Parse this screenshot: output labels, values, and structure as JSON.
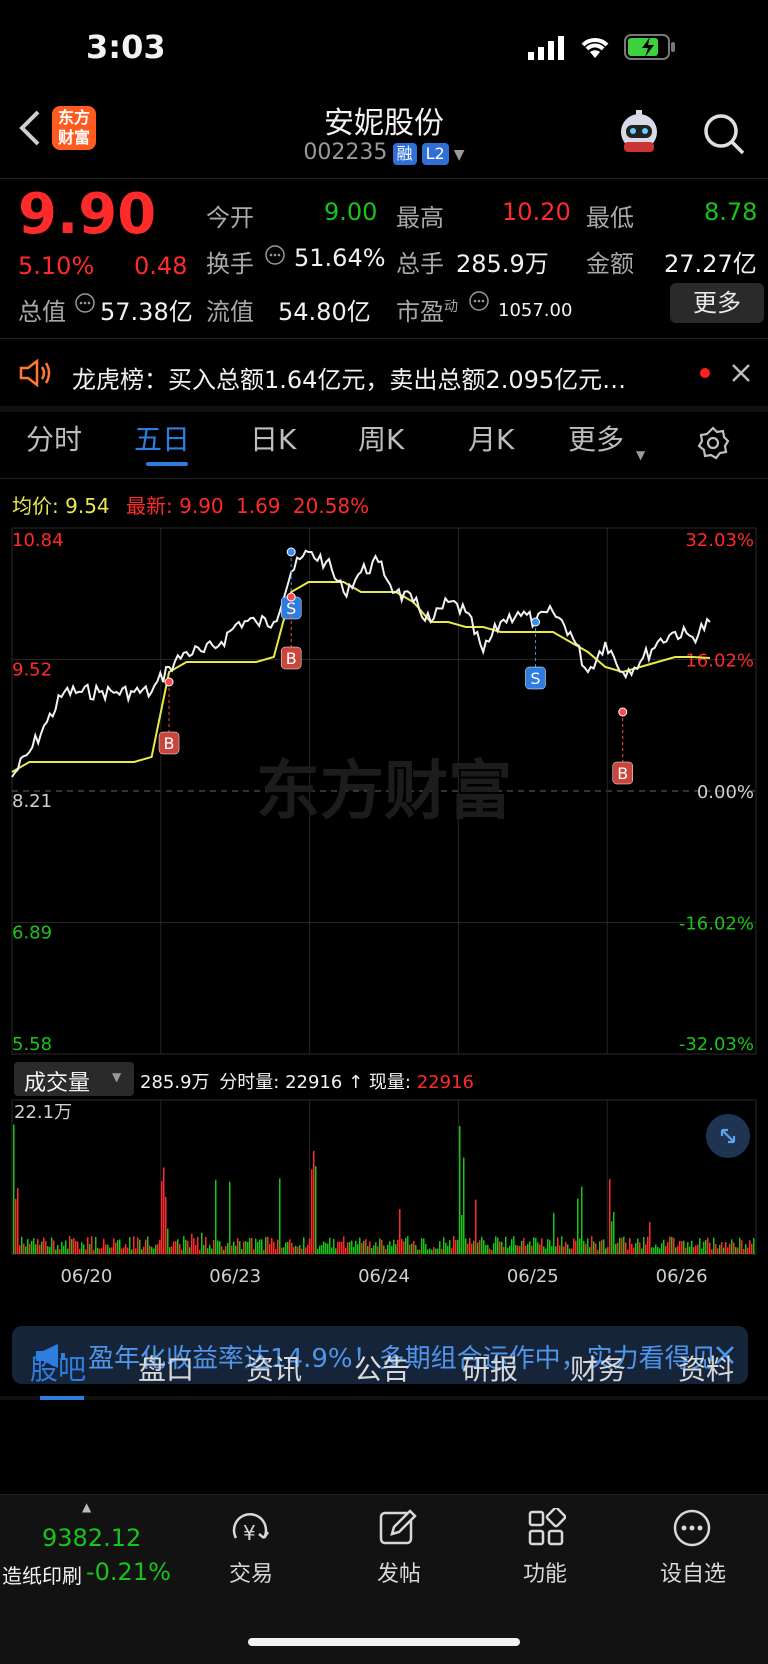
{
  "status_bar": {
    "time": "3:03"
  },
  "header": {
    "title": "安妮股份",
    "code": "002235",
    "badge_margin": "融",
    "badge_level": "L2",
    "logo_line1": "东方",
    "logo_line2": "财富"
  },
  "quote": {
    "price": "9.90",
    "change_pct": "5.10%",
    "change_amt": "0.48",
    "open_label": "今开",
    "open": "9.00",
    "high_label": "最高",
    "high": "10.20",
    "low_label": "最低",
    "low": "8.78",
    "turnover_label": "换手",
    "turnover": "51.64%",
    "volume_label": "总手",
    "volume": "285.9万",
    "amount_label": "金额",
    "amount": "27.27亿",
    "mktcap_label": "总值",
    "mktcap": "57.38亿",
    "float_label": "流值",
    "float": "54.80亿",
    "pe_label": "市盈",
    "pe_sup": "动",
    "pe": "1057.00",
    "more_button": "更多"
  },
  "notice": {
    "text": "龙虎榜：买入总额1.64亿元，卖出总额2.095亿元…"
  },
  "tabs": [
    "分时",
    "五日",
    "日K",
    "周K",
    "月K",
    "更多"
  ],
  "active_tab": "五日",
  "chart_header": {
    "avg_label": "均价:",
    "avg": "9.54",
    "latest_label": "最新:",
    "latest": "9.90",
    "chg": "1.69",
    "chg_pct": "20.58%"
  },
  "volume_header": {
    "label": "成交量",
    "total": "285.9万",
    "tick_label": "分时量:",
    "tick_val": "22916",
    "now_label": "现量:",
    "now_val": "22916"
  },
  "chart_data": {
    "type": "line",
    "price_axis_left": [
      "10.84",
      "9.52",
      "8.21",
      "6.89",
      "5.58"
    ],
    "price_axis_right": [
      "32.03%",
      "16.02%",
      "0.00%",
      "-16.02%",
      "-32.03%"
    ],
    "volume_axis_top": "22.1万",
    "x_labels": [
      "06/20",
      "06/23",
      "06/24",
      "06/25",
      "06/26"
    ],
    "prev_close": 8.21,
    "ylim": [
      5.58,
      10.84
    ],
    "series": [
      {
        "values": [
          8.35,
          8.6,
          8.9,
          9.2,
          9.2,
          9.2,
          9.2,
          9.2,
          9.2,
          9.45,
          9.6,
          9.6,
          9.7,
          9.9,
          9.9,
          9.9,
          10.4,
          10.6,
          10.5,
          10.2,
          10.4,
          10.5,
          10.2,
          10.1,
          9.9,
          10.1,
          10.0,
          9.6,
          9.9,
          10.0,
          9.9,
          10.0,
          9.8,
          9.4,
          9.7,
          9.4,
          9.5,
          9.7,
          9.8,
          9.75,
          9.9
        ]
      },
      {
        "values": [
          8.4,
          8.5,
          8.5,
          8.5,
          8.5,
          8.5,
          8.5,
          8.5,
          8.55,
          9.4,
          9.5,
          9.5,
          9.5,
          9.5,
          9.5,
          9.55,
          10.2,
          10.3,
          10.3,
          10.3,
          10.2,
          10.2,
          10.2,
          10.1,
          9.9,
          9.9,
          9.85,
          9.85,
          9.8,
          9.8,
          9.8,
          9.8,
          9.7,
          9.6,
          9.45,
          9.4,
          9.45,
          9.5,
          9.55,
          9.55,
          9.54
        ]
      }
    ],
    "trade_marks": [
      {
        "label": "B",
        "x_index": 9,
        "price": 9.3
      },
      {
        "label": "S",
        "x_index": 16,
        "price": 10.6
      },
      {
        "label": "B",
        "x_index": 16,
        "price": 10.15
      },
      {
        "label": "S",
        "x_index": 30,
        "price": 9.9
      },
      {
        "label": "B",
        "x_index": 35,
        "price": 9.0
      }
    ],
    "watermark": "东方财富"
  },
  "banner": {
    "text": "盈年化收益率达14.9%！多期组合运作中，实力看得见"
  },
  "bottom_tabs": [
    "股吧",
    "盘口",
    "资讯",
    "公告",
    "研报",
    "财务",
    "资料"
  ],
  "active_bottom_tab": "股吧",
  "bottom_nav": {
    "index_value": "9382.12",
    "index_name": "造纸印刷",
    "index_change": "-0.21%",
    "items": [
      "交易",
      "发帖",
      "功能",
      "设自选"
    ]
  },
  "colors": {
    "up": "#ff2a2a",
    "down": "#19c419",
    "price_line": "#f2f2f2",
    "avg_line": "#e9e94a",
    "accent": "#2e7ee0"
  }
}
